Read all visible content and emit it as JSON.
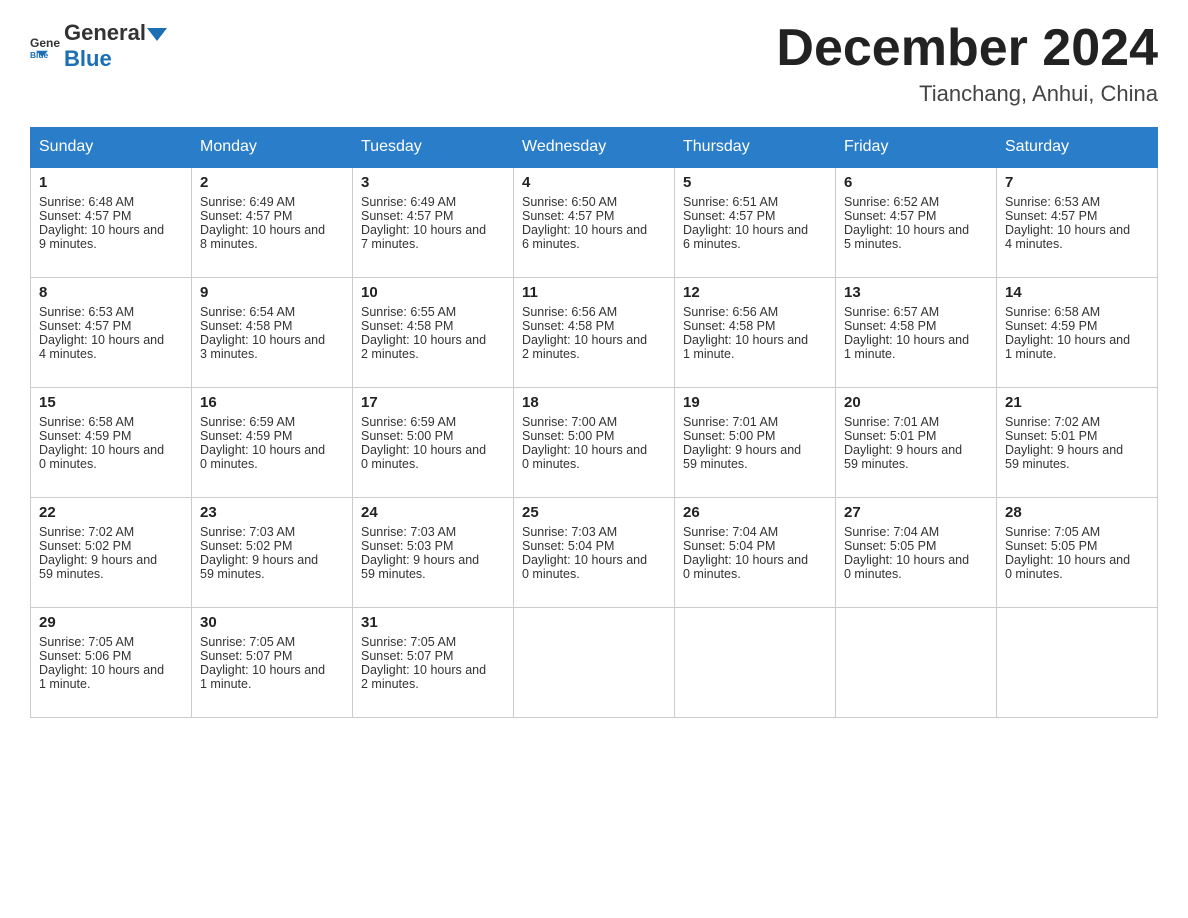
{
  "header": {
    "logo_text_general": "General",
    "logo_text_blue": "Blue",
    "month_title": "December 2024",
    "subtitle": "Tianchang, Anhui, China"
  },
  "days_of_week": [
    "Sunday",
    "Monday",
    "Tuesday",
    "Wednesday",
    "Thursday",
    "Friday",
    "Saturday"
  ],
  "weeks": [
    [
      {
        "day": "1",
        "sunrise": "6:48 AM",
        "sunset": "4:57 PM",
        "daylight": "10 hours and 9 minutes."
      },
      {
        "day": "2",
        "sunrise": "6:49 AM",
        "sunset": "4:57 PM",
        "daylight": "10 hours and 8 minutes."
      },
      {
        "day": "3",
        "sunrise": "6:49 AM",
        "sunset": "4:57 PM",
        "daylight": "10 hours and 7 minutes."
      },
      {
        "day": "4",
        "sunrise": "6:50 AM",
        "sunset": "4:57 PM",
        "daylight": "10 hours and 6 minutes."
      },
      {
        "day": "5",
        "sunrise": "6:51 AM",
        "sunset": "4:57 PM",
        "daylight": "10 hours and 6 minutes."
      },
      {
        "day": "6",
        "sunrise": "6:52 AM",
        "sunset": "4:57 PM",
        "daylight": "10 hours and 5 minutes."
      },
      {
        "day": "7",
        "sunrise": "6:53 AM",
        "sunset": "4:57 PM",
        "daylight": "10 hours and 4 minutes."
      }
    ],
    [
      {
        "day": "8",
        "sunrise": "6:53 AM",
        "sunset": "4:57 PM",
        "daylight": "10 hours and 4 minutes."
      },
      {
        "day": "9",
        "sunrise": "6:54 AM",
        "sunset": "4:58 PM",
        "daylight": "10 hours and 3 minutes."
      },
      {
        "day": "10",
        "sunrise": "6:55 AM",
        "sunset": "4:58 PM",
        "daylight": "10 hours and 2 minutes."
      },
      {
        "day": "11",
        "sunrise": "6:56 AM",
        "sunset": "4:58 PM",
        "daylight": "10 hours and 2 minutes."
      },
      {
        "day": "12",
        "sunrise": "6:56 AM",
        "sunset": "4:58 PM",
        "daylight": "10 hours and 1 minute."
      },
      {
        "day": "13",
        "sunrise": "6:57 AM",
        "sunset": "4:58 PM",
        "daylight": "10 hours and 1 minute."
      },
      {
        "day": "14",
        "sunrise": "6:58 AM",
        "sunset": "4:59 PM",
        "daylight": "10 hours and 1 minute."
      }
    ],
    [
      {
        "day": "15",
        "sunrise": "6:58 AM",
        "sunset": "4:59 PM",
        "daylight": "10 hours and 0 minutes."
      },
      {
        "day": "16",
        "sunrise": "6:59 AM",
        "sunset": "4:59 PM",
        "daylight": "10 hours and 0 minutes."
      },
      {
        "day": "17",
        "sunrise": "6:59 AM",
        "sunset": "5:00 PM",
        "daylight": "10 hours and 0 minutes."
      },
      {
        "day": "18",
        "sunrise": "7:00 AM",
        "sunset": "5:00 PM",
        "daylight": "10 hours and 0 minutes."
      },
      {
        "day": "19",
        "sunrise": "7:01 AM",
        "sunset": "5:00 PM",
        "daylight": "9 hours and 59 minutes."
      },
      {
        "day": "20",
        "sunrise": "7:01 AM",
        "sunset": "5:01 PM",
        "daylight": "9 hours and 59 minutes."
      },
      {
        "day": "21",
        "sunrise": "7:02 AM",
        "sunset": "5:01 PM",
        "daylight": "9 hours and 59 minutes."
      }
    ],
    [
      {
        "day": "22",
        "sunrise": "7:02 AM",
        "sunset": "5:02 PM",
        "daylight": "9 hours and 59 minutes."
      },
      {
        "day": "23",
        "sunrise": "7:03 AM",
        "sunset": "5:02 PM",
        "daylight": "9 hours and 59 minutes."
      },
      {
        "day": "24",
        "sunrise": "7:03 AM",
        "sunset": "5:03 PM",
        "daylight": "9 hours and 59 minutes."
      },
      {
        "day": "25",
        "sunrise": "7:03 AM",
        "sunset": "5:04 PM",
        "daylight": "10 hours and 0 minutes."
      },
      {
        "day": "26",
        "sunrise": "7:04 AM",
        "sunset": "5:04 PM",
        "daylight": "10 hours and 0 minutes."
      },
      {
        "day": "27",
        "sunrise": "7:04 AM",
        "sunset": "5:05 PM",
        "daylight": "10 hours and 0 minutes."
      },
      {
        "day": "28",
        "sunrise": "7:05 AM",
        "sunset": "5:05 PM",
        "daylight": "10 hours and 0 minutes."
      }
    ],
    [
      {
        "day": "29",
        "sunrise": "7:05 AM",
        "sunset": "5:06 PM",
        "daylight": "10 hours and 1 minute."
      },
      {
        "day": "30",
        "sunrise": "7:05 AM",
        "sunset": "5:07 PM",
        "daylight": "10 hours and 1 minute."
      },
      {
        "day": "31",
        "sunrise": "7:05 AM",
        "sunset": "5:07 PM",
        "daylight": "10 hours and 2 minutes."
      },
      null,
      null,
      null,
      null
    ]
  ],
  "labels": {
    "sunrise": "Sunrise:",
    "sunset": "Sunset:",
    "daylight": "Daylight:"
  }
}
